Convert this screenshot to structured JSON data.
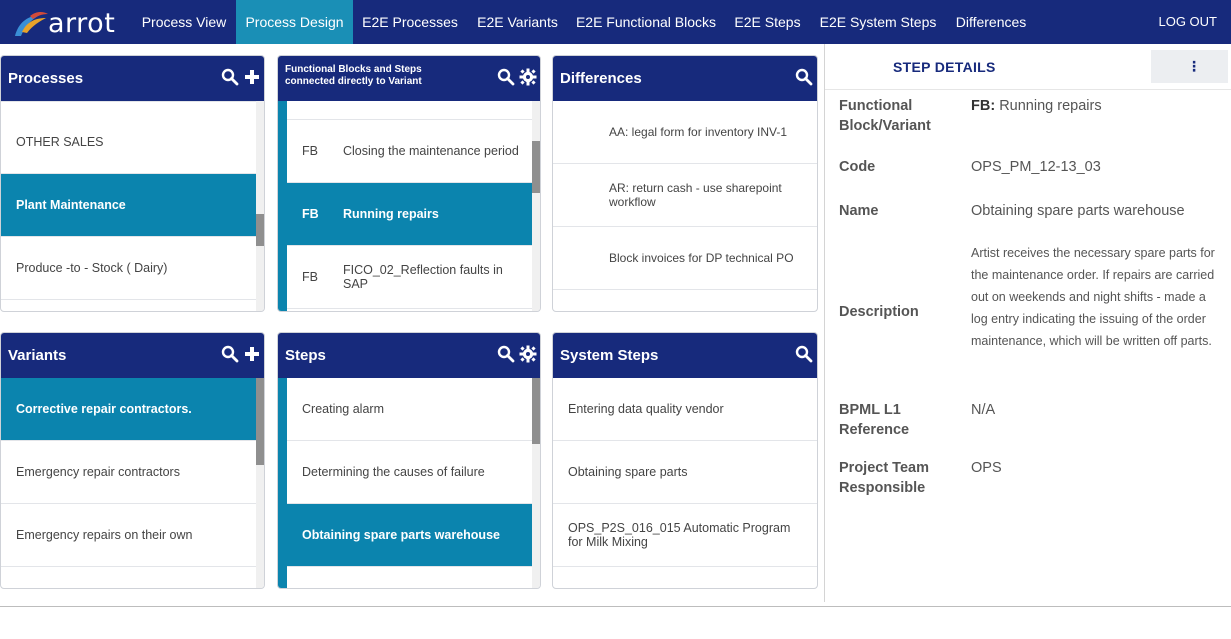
{
  "nav": {
    "logo_text": "arrot",
    "tabs": [
      "Process View",
      "Process Design",
      "E2E Processes",
      "E2E Variants",
      "E2E Functional Blocks",
      "E2E Steps",
      "E2E System Steps",
      "Differences"
    ],
    "active_tab": "Process Design",
    "logout": "LOG OUT"
  },
  "processes": {
    "title": "Processes",
    "items": [
      "OTHER SALES",
      "Plant Maintenance",
      "Produce -to - Stock ( Dairy)"
    ],
    "selected": "Plant Maintenance"
  },
  "functional_blocks": {
    "title": "Functional Blocks and Steps connected directly to Variant",
    "items": [
      {
        "tag": "FB",
        "label": "Closing the maintenance period"
      },
      {
        "tag": "FB",
        "label": "Running repairs"
      },
      {
        "tag": "FB",
        "label": "FICO_02_Reflection faults in SAP"
      }
    ],
    "selected": "Running repairs"
  },
  "differences": {
    "title": "Differences",
    "items": [
      "AA: legal form for inventory INV-1",
      "AR: return cash - use sharepoint workflow",
      "Block invoices for DP technical PO"
    ]
  },
  "variants": {
    "title": "Variants",
    "items": [
      "Corrective repair contractors.",
      "Emergency repair contractors",
      "Emergency repairs on their own"
    ],
    "selected": "Corrective repair contractors."
  },
  "steps": {
    "title": "Steps",
    "items": [
      "Creating alarm",
      "Determining the causes of failure",
      "Obtaining spare parts warehouse"
    ],
    "selected": "Obtaining spare parts warehouse"
  },
  "system_steps": {
    "title": "System Steps",
    "items": [
      "Entering data quality vendor",
      "Obtaining spare parts",
      "OPS_P2S_016_015 Automatic Program for Milk Mixing"
    ]
  },
  "details": {
    "title": "STEP DETAILS",
    "menu_icon": "⋮",
    "fields": {
      "fb_label": "Functional Block/Variant",
      "fb_prefix": "FB:",
      "fb_value": "Running repairs",
      "code_label": "Code",
      "code_value": "OPS_PM_12-13_03",
      "name_label": "Name",
      "name_value": "Obtaining spare parts warehouse",
      "desc_label": "Description",
      "desc_value": "Artist receives the necessary spare parts for the maintenance order. If repairs are carried out on weekends and night shifts - made a log entry indicating the issuing of the order maintenance, which will be written off parts.",
      "bpml_label": "BPML L1 Reference",
      "bpml_value": "N/A",
      "team_label": "Project Team Responsible",
      "team_value": "OPS"
    }
  },
  "colors": {
    "nav": "#172a7c",
    "accent": "#0b84ae",
    "active_tab": "#1a8fb6"
  }
}
